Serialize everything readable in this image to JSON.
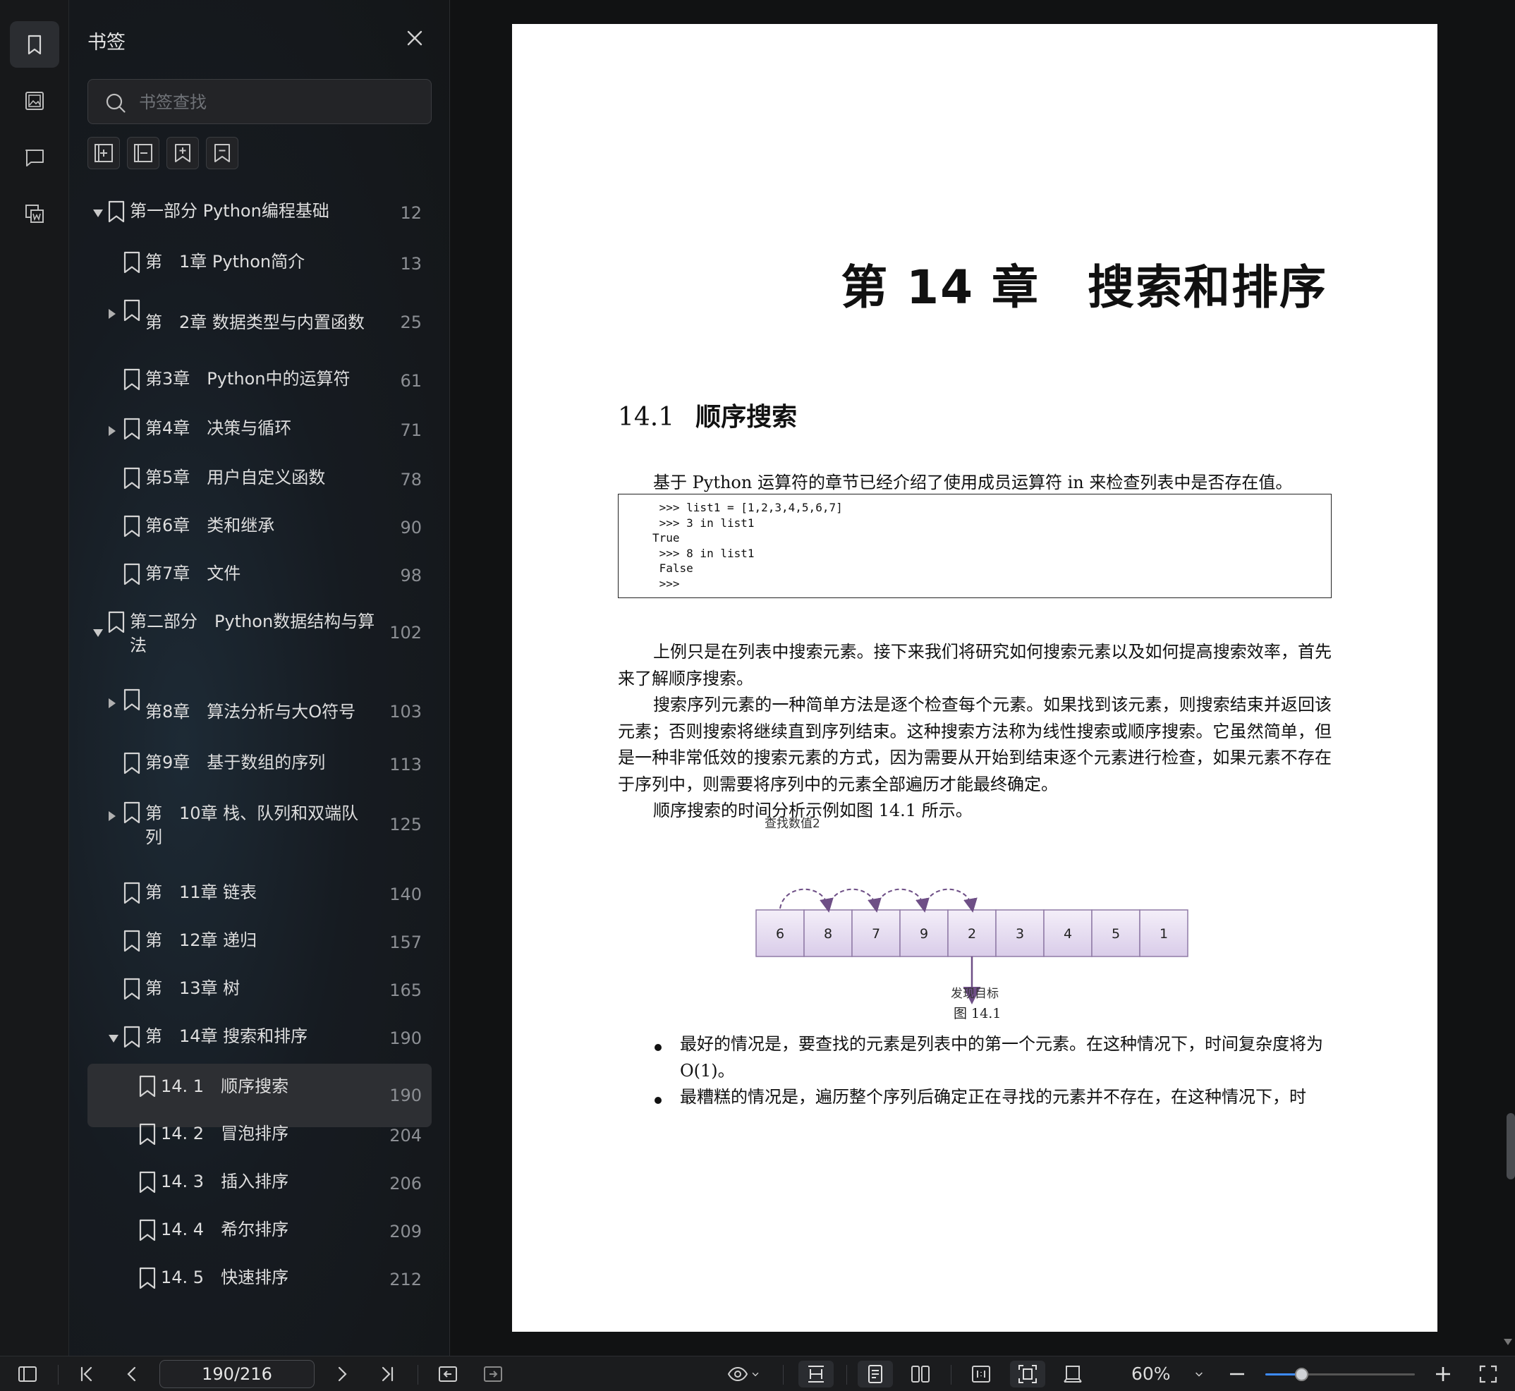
{
  "sidebar": {
    "title": "书签",
    "search_placeholder": "书签查找",
    "bookmarks": [
      {
        "label": "第一部分 Python编程基础",
        "page": "12",
        "expanded": true,
        "level": 0
      },
      {
        "label": "第　1章 Python简介",
        "page": "13",
        "level": 1
      },
      {
        "label": "第　2章 数据类型与内置函数",
        "page": "25",
        "collapsed": true,
        "level": 1
      },
      {
        "label": "第3章　Python中的运算符",
        "page": "61",
        "level": 1
      },
      {
        "label": "第4章　决策与循环",
        "page": "71",
        "collapsed": true,
        "level": 1
      },
      {
        "label": "第5章　用户自定义函数",
        "page": "78",
        "level": 1
      },
      {
        "label": "第6章　类和继承",
        "page": "90",
        "level": 1
      },
      {
        "label": "第7章　文件",
        "page": "98",
        "level": 1
      },
      {
        "label": "第二部分　Python数据结构与算\n法",
        "page": "102",
        "expanded": true,
        "level": 0
      },
      {
        "label": "第8章　算法分析与大O符号",
        "page": "103",
        "collapsed": true,
        "level": 1
      },
      {
        "label": "第9章　基于数组的序列",
        "page": "113",
        "level": 1
      },
      {
        "label": "第　10章 栈、队列和双端队\n列",
        "page": "125",
        "collapsed": true,
        "level": 1
      },
      {
        "label": "第　11章 链表",
        "page": "140",
        "level": 1
      },
      {
        "label": "第　12章 递归",
        "page": "157",
        "level": 1
      },
      {
        "label": "第　13章 树",
        "page": "165",
        "level": 1
      },
      {
        "label": "第　14章 搜索和排序",
        "page": "190",
        "expanded": true,
        "level": 1
      },
      {
        "label": "14. 1　顺序搜索",
        "page": "190",
        "active": true,
        "level": 2
      },
      {
        "label": "14. 2　冒泡排序",
        "page": "204",
        "level": 2
      },
      {
        "label": "14. 3　插入排序",
        "page": "206",
        "level": 2
      },
      {
        "label": "14. 4　希尔排序",
        "page": "209",
        "level": 2
      },
      {
        "label": "14. 5　快速排序",
        "page": "212",
        "level": 2
      }
    ]
  },
  "document": {
    "chapter_title": "第 14 章　搜索和排序",
    "section_number": "14.1",
    "section_title": "顺序搜索",
    "intro": "基于 Python 运算符的章节已经介绍了使用成员运算符 in 来检查列表中是否存在值。",
    "code": " >>> list1 = [1,2,3,4,5,6,7]\n >>> 3 in list1\nTrue\n >>> 8 in list1\n False\n >>>",
    "para1": "上例只是在列表中搜索元素。接下来我们将研究如何搜索元素以及如何提高搜索效率，首先来了解顺序搜索。",
    "para2": "搜索序列元素的一种简单方法是逐个检查每个元素。如果找到该元素，则搜索结束并返回该元素；否则搜索将继续直到序列结束。这种搜索方法称为线性搜索或顺序搜索。它虽然简单，但是一种非常低效的搜索元素的方式，因为需要从开始到结束逐个元素进行检查，如果元素不存在于序列中，则需要将序列中的元素全部遍历才能最终确定。",
    "para3": "顺序搜索的时间分析示例如图 14.1 所示。",
    "figure": {
      "search_label": "查找数值2",
      "cells": [
        "6",
        "8",
        "7",
        "9",
        "2",
        "3",
        "4",
        "5",
        "1"
      ],
      "found_label": "发现目标",
      "caption": "图 14.1"
    },
    "bullet1": "最好的情况是，要查找的元素是列表中的第一个元素。在这种情况下，时间复杂度将为 O(1)。",
    "bullet2": "最糟糕的情况是，遍历整个序列后确定正在寻找的元素并不存在，在这种情况下，时"
  },
  "toolbar": {
    "page_value": "190/216",
    "zoom": "60%",
    "zoom_fraction": 0.24
  },
  "colors": {
    "accent": "#3d8bff",
    "cell_fill": "#d9cce9",
    "arrow": "#6e4f86"
  }
}
